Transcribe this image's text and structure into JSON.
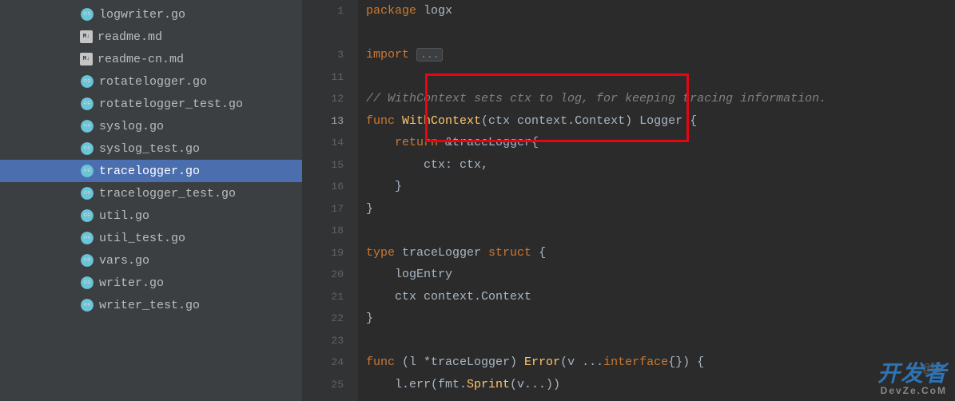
{
  "sidebar": {
    "files": [
      {
        "name": "logwriter.go",
        "type": "go",
        "selected": false
      },
      {
        "name": "readme.md",
        "type": "md",
        "selected": false
      },
      {
        "name": "readme-cn.md",
        "type": "md",
        "selected": false
      },
      {
        "name": "rotatelogger.go",
        "type": "go",
        "selected": false
      },
      {
        "name": "rotatelogger_test.go",
        "type": "go",
        "selected": false
      },
      {
        "name": "syslog.go",
        "type": "go",
        "selected": false
      },
      {
        "name": "syslog_test.go",
        "type": "go",
        "selected": false
      },
      {
        "name": "tracelogger.go",
        "type": "go",
        "selected": true
      },
      {
        "name": "tracelogger_test.go",
        "type": "go",
        "selected": false
      },
      {
        "name": "util.go",
        "type": "go",
        "selected": false
      },
      {
        "name": "util_test.go",
        "type": "go",
        "selected": false
      },
      {
        "name": "vars.go",
        "type": "go",
        "selected": false
      },
      {
        "name": "writer.go",
        "type": "go",
        "selected": false
      },
      {
        "name": "writer_test.go",
        "type": "go",
        "selected": false
      }
    ]
  },
  "editor": {
    "md_icon_text": "M↓",
    "gutter": {
      "lines": [
        "1",
        "",
        "3",
        "11",
        "12",
        "13",
        "14",
        "15",
        "16",
        "17",
        "18",
        "19",
        "20",
        "21",
        "22",
        "23",
        "24",
        "25"
      ],
      "active_line": "13"
    },
    "code": {
      "l1_kw": "package",
      "l1_pkg": " logx",
      "l3_kw": "import",
      "l3_fold": "...",
      "l12_comment": "// WithContext sets ctx to log, for keeping tracing information.",
      "l13_kw": "func",
      "l13_name": " WithContext",
      "l13_sig_a": "(ctx context.",
      "l13_ctx": "Context",
      "l13_sig_b": ") Logger {",
      "l14_indent": "    ",
      "l14_kw": "return",
      "l14_rest": " &traceLogger{",
      "l15": "        ctx: ctx,",
      "l16": "    }",
      "l17": "}",
      "l19_kw": "type",
      "l19_name": " traceLogger",
      "l19_kw2": " struct",
      "l19_brace": " {",
      "l20": "    logEntry",
      "l21_a": "    ctx context.",
      "l21_ctx": "Context",
      "l22": "}",
      "l24_kw": "func",
      "l24_recv": " (l *traceLogger) ",
      "l24_name": "Error",
      "l24_sig_a": "(v ...",
      "l24_kw2": "interface",
      "l24_sig_b": "{}) {",
      "l25_a": "    l.err(fmt.",
      "l25_fn": "Sprint",
      "l25_b": "(v...))"
    },
    "at_mark": "@稀"
  },
  "watermark": {
    "main": "开发者",
    "sub": "DevZe.CoM"
  }
}
